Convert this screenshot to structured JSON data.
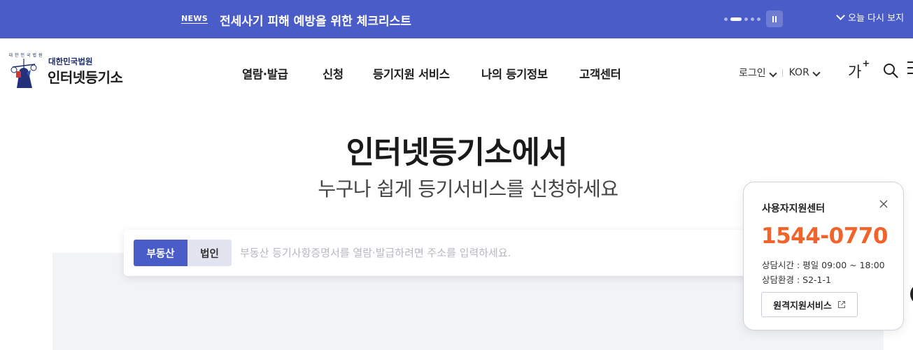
{
  "news": {
    "tag": "NEWS",
    "headline": "전세사기 피해 예방을 위한 체크리스트",
    "dont_show_today": "오늘 다시 보지"
  },
  "logo": {
    "org": "대한민국법원",
    "name": "인터넷등기소",
    "emblem_text": "대한민국법원"
  },
  "gnb": [
    {
      "label": "열람·발급"
    },
    {
      "label": "신청"
    },
    {
      "label": "등기지원 서비스"
    },
    {
      "label": "나의 등기정보"
    },
    {
      "label": "고객센터"
    }
  ],
  "util": {
    "login": "로그인",
    "language": "KOR",
    "font_size_label": "가",
    "font_size_plus": "+"
  },
  "hero": {
    "title": "인터넷등기소에서",
    "subtitle": "누구나 쉽게 등기서비스를 신청하세요"
  },
  "search": {
    "tabs": [
      {
        "label": "부동산",
        "active": true
      },
      {
        "label": "법인",
        "active": false
      }
    ],
    "placeholder": "부동산 등기사항증명서를 열람·발급하려면 주소를 입력하세요.",
    "value": ""
  },
  "support": {
    "title": "사용자지원센터",
    "phone": "1544-0770",
    "hours": "상담시간 : 평일 09:00 ~ 18:00",
    "environment": "상담환경 : S2-1-1",
    "remote_button": "원격지원서비스"
  },
  "colors": {
    "brand_blue": "#4a5cc7",
    "phone_orange": "#f0632b"
  },
  "icons": [
    "pause-icon",
    "chevron-down-icon",
    "search-icon",
    "menu-icon",
    "close-icon",
    "external-link-icon"
  ]
}
